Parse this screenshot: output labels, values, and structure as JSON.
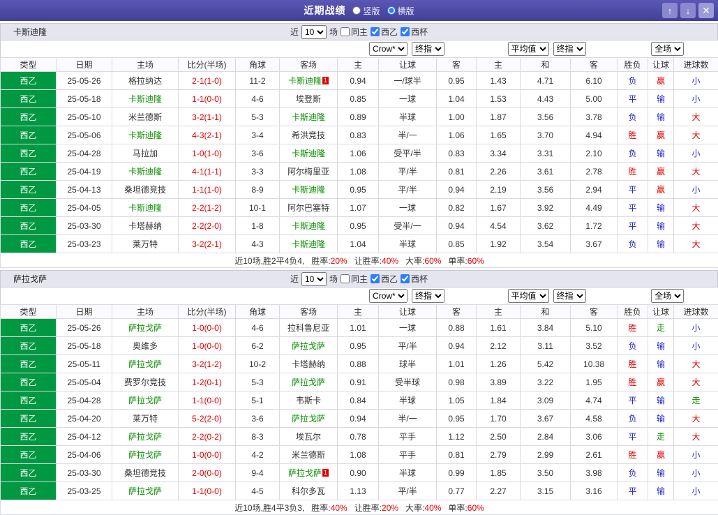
{
  "titlebar": {
    "title": "近期战绩",
    "layout_options": [
      {
        "label": "竖版",
        "selected": false
      },
      {
        "label": "横版",
        "selected": true
      }
    ],
    "icons": {
      "up": "↑",
      "down": "↓",
      "close": "✕"
    }
  },
  "labels": {
    "near": "近",
    "count": "10",
    "matches": "场",
    "same_home": "同主",
    "league_a": "西乙",
    "league_b": "西杯",
    "crow": "Crow*",
    "final_odds": "终指",
    "average": "平均值",
    "full_match": "全场",
    "cols": [
      "类型",
      "日期",
      "主场",
      "比分(半场)",
      "角球",
      "客场",
      "主",
      "让球",
      "客",
      "主",
      "和",
      "客",
      "胜负",
      "让球",
      "进球数"
    ]
  },
  "sections": [
    {
      "team": "卡斯迪隆",
      "rows": [
        {
          "league": "西乙",
          "date": "25-05-26",
          "home": "格拉纳达",
          "home_focal": false,
          "score": "2-1(1-0)",
          "corners": "11-2",
          "away": "卡斯迪隆",
          "away_focal": true,
          "away_card": "1",
          "odds": [
            "0.94",
            "一/球半",
            "0.95"
          ],
          "avg": [
            "1.43",
            "4.71",
            "6.10"
          ],
          "win_loss": "负",
          "handicap_result": "赢",
          "goals": "小"
        },
        {
          "league": "西乙",
          "date": "25-05-18",
          "home": "卡斯迪隆",
          "home_focal": true,
          "score": "1-1(0-0)",
          "corners": "4-6",
          "away": "埃登斯",
          "away_focal": false,
          "odds": [
            "0.85",
            "一球",
            "1.04"
          ],
          "avg": [
            "1.53",
            "4.43",
            "5.00"
          ],
          "win_loss": "平",
          "handicap_result": "输",
          "goals": "小"
        },
        {
          "league": "西乙",
          "date": "25-05-10",
          "home": "米兰德斯",
          "home_focal": false,
          "score": "3-2(1-1)",
          "corners": "5-3",
          "away": "卡斯迪隆",
          "away_focal": true,
          "odds": [
            "0.89",
            "半球",
            "1.00"
          ],
          "avg": [
            "1.87",
            "3.56",
            "3.78"
          ],
          "win_loss": "负",
          "handicap_result": "输",
          "goals": "大"
        },
        {
          "league": "西乙",
          "date": "25-05-06",
          "home": "卡斯迪隆",
          "home_focal": true,
          "score": "4-3(2-1)",
          "corners": "3-4",
          "away": "希洪竞技",
          "away_focal": false,
          "odds": [
            "0.83",
            "半/一",
            "1.06"
          ],
          "avg": [
            "1.65",
            "3.70",
            "4.94"
          ],
          "win_loss": "胜",
          "handicap_result": "赢",
          "goals": "大"
        },
        {
          "league": "西乙",
          "date": "25-04-28",
          "home": "马拉加",
          "home_focal": false,
          "score": "1-0(1-0)",
          "corners": "3-6",
          "away": "卡斯迪隆",
          "away_focal": true,
          "odds": [
            "1.06",
            "受平/半",
            "0.83"
          ],
          "avg": [
            "3.34",
            "3.31",
            "2.10"
          ],
          "win_loss": "负",
          "handicap_result": "输",
          "goals": "小"
        },
        {
          "league": "西乙",
          "date": "25-04-19",
          "home": "卡斯迪隆",
          "home_focal": true,
          "score": "4-1(1-1)",
          "corners": "3-3",
          "away": "阿尔梅里亚",
          "away_focal": false,
          "odds": [
            "1.08",
            "平/半",
            "0.81"
          ],
          "avg": [
            "2.26",
            "3.61",
            "2.78"
          ],
          "win_loss": "胜",
          "handicap_result": "赢",
          "goals": "大"
        },
        {
          "league": "西乙",
          "date": "25-04-13",
          "home": "桑坦德竞技",
          "home_focal": false,
          "score": "1-1(1-0)",
          "corners": "8-9",
          "away": "卡斯迪隆",
          "away_focal": true,
          "odds": [
            "0.95",
            "平/半",
            "0.94"
          ],
          "avg": [
            "2.19",
            "3.56",
            "2.94"
          ],
          "win_loss": "平",
          "handicap_result": "赢",
          "goals": "小"
        },
        {
          "league": "西乙",
          "date": "25-04-05",
          "home": "卡斯迪隆",
          "home_focal": true,
          "score": "2-2(1-2)",
          "corners": "10-1",
          "away": "阿尔巴塞特",
          "away_focal": false,
          "odds": [
            "1.07",
            "一球",
            "0.82"
          ],
          "avg": [
            "1.67",
            "3.92",
            "4.49"
          ],
          "win_loss": "平",
          "handicap_result": "输",
          "goals": "大"
        },
        {
          "league": "西乙",
          "date": "25-03-30",
          "home": "卡塔赫纳",
          "home_focal": false,
          "score": "2-2(2-0)",
          "corners": "1-8",
          "away": "卡斯迪隆",
          "away_focal": true,
          "odds": [
            "0.95",
            "受半/一",
            "0.94"
          ],
          "avg": [
            "4.54",
            "3.62",
            "1.72"
          ],
          "win_loss": "平",
          "handicap_result": "输",
          "goals": "大"
        },
        {
          "league": "西乙",
          "date": "25-03-23",
          "home": "莱万特",
          "home_focal": false,
          "score": "3-2(2-1)",
          "corners": "4-3",
          "away": "卡斯迪隆",
          "away_focal": true,
          "odds": [
            "1.04",
            "半球",
            "0.85"
          ],
          "avg": [
            "1.92",
            "3.54",
            "3.67"
          ],
          "win_loss": "负",
          "handicap_result": "输",
          "goals": "大"
        }
      ],
      "summary": {
        "record": "近10场,胜2平4负4,",
        "stats": [
          {
            "label": "胜率:",
            "value": "20%"
          },
          {
            "label": "让胜率:",
            "value": "40%"
          },
          {
            "label": "大率:",
            "value": "60%"
          },
          {
            "label": "单率:",
            "value": "60%"
          }
        ]
      }
    },
    {
      "team": "萨拉戈萨",
      "rows": [
        {
          "league": "西乙",
          "date": "25-05-26",
          "home": "萨拉戈萨",
          "home_focal": true,
          "score": "1-0(0-0)",
          "corners": "4-6",
          "away": "拉科鲁尼亚",
          "away_focal": false,
          "odds": [
            "1.01",
            "一球",
            "0.88"
          ],
          "avg": [
            "1.61",
            "3.84",
            "5.10"
          ],
          "win_loss": "胜",
          "handicap_result": "走",
          "goals": "小"
        },
        {
          "league": "西乙",
          "date": "25-05-18",
          "home": "奥维多",
          "home_focal": false,
          "score": "1-0(0-0)",
          "corners": "6-2",
          "away": "萨拉戈萨",
          "away_focal": true,
          "odds": [
            "0.95",
            "平/半",
            "0.94"
          ],
          "avg": [
            "2.12",
            "3.11",
            "3.52"
          ],
          "win_loss": "负",
          "handicap_result": "输",
          "goals": "小"
        },
        {
          "league": "西乙",
          "date": "25-05-11",
          "home": "萨拉戈萨",
          "home_focal": true,
          "score": "3-2(1-2)",
          "corners": "10-2",
          "away": "卡塔赫纳",
          "away_focal": false,
          "odds": [
            "0.88",
            "球半",
            "1.01"
          ],
          "avg": [
            "1.26",
            "5.42",
            "10.38"
          ],
          "win_loss": "胜",
          "handicap_result": "输",
          "goals": "大"
        },
        {
          "league": "西乙",
          "date": "25-05-04",
          "home": "费罗尔竞技",
          "home_focal": false,
          "score": "1-2(0-1)",
          "corners": "5-3",
          "away": "萨拉戈萨",
          "away_focal": true,
          "odds": [
            "0.91",
            "受半球",
            "0.98"
          ],
          "avg": [
            "3.89",
            "3.22",
            "1.95"
          ],
          "win_loss": "胜",
          "handicap_result": "赢",
          "goals": "大"
        },
        {
          "league": "西乙",
          "date": "25-04-28",
          "home": "萨拉戈萨",
          "home_focal": true,
          "score": "1-1(0-0)",
          "corners": "5-1",
          "away": "韦斯卡",
          "away_focal": false,
          "odds": [
            "0.84",
            "半球",
            "1.05"
          ],
          "avg": [
            "1.84",
            "3.09",
            "4.74"
          ],
          "win_loss": "平",
          "handicap_result": "输",
          "goals": "走"
        },
        {
          "league": "西乙",
          "date": "25-04-20",
          "home": "莱万特",
          "home_focal": false,
          "score": "5-2(2-0)",
          "corners": "3-6",
          "away": "萨拉戈萨",
          "away_focal": true,
          "odds": [
            "0.94",
            "半/一",
            "0.95"
          ],
          "avg": [
            "1.70",
            "3.67",
            "4.58"
          ],
          "win_loss": "负",
          "handicap_result": "输",
          "goals": "大"
        },
        {
          "league": "西乙",
          "date": "25-04-12",
          "home": "萨拉戈萨",
          "home_focal": true,
          "score": "2-2(0-2)",
          "corners": "8-3",
          "away": "埃瓦尔",
          "away_focal": false,
          "odds": [
            "0.78",
            "平手",
            "1.12"
          ],
          "avg": [
            "2.50",
            "2.84",
            "3.06"
          ],
          "win_loss": "平",
          "handicap_result": "走",
          "goals": "大"
        },
        {
          "league": "西乙",
          "date": "25-04-06",
          "home": "萨拉戈萨",
          "home_focal": true,
          "score": "1-0(0-0)",
          "corners": "4-2",
          "away": "米兰德斯",
          "away_focal": false,
          "odds": [
            "1.08",
            "平手",
            "0.81"
          ],
          "avg": [
            "2.79",
            "2.99",
            "2.61"
          ],
          "win_loss": "胜",
          "handicap_result": "赢",
          "goals": "小"
        },
        {
          "league": "西乙",
          "date": "25-03-30",
          "home": "桑坦德竞技",
          "home_focal": false,
          "score": "2-0(0-0)",
          "corners": "9-4",
          "away": "萨拉戈萨",
          "away_focal": true,
          "away_card": "1",
          "odds": [
            "0.90",
            "半球",
            "0.99"
          ],
          "avg": [
            "1.85",
            "3.50",
            "3.98"
          ],
          "win_loss": "负",
          "handicap_result": "输",
          "goals": "小"
        },
        {
          "league": "西乙",
          "date": "25-03-25",
          "home": "萨拉戈萨",
          "home_focal": true,
          "score": "1-1(0-0)",
          "corners": "4-5",
          "away": "科尔多瓦",
          "away_focal": false,
          "odds": [
            "1.13",
            "平/半",
            "0.77"
          ],
          "avg": [
            "2.27",
            "3.15",
            "3.16"
          ],
          "win_loss": "平",
          "handicap_result": "输",
          "goals": "小"
        }
      ],
      "summary": {
        "record": "近10场,胜4平3负3,",
        "stats": [
          {
            "label": "胜率:",
            "value": "40%"
          },
          {
            "label": "让胜率:",
            "value": "20%"
          },
          {
            "label": "大率:",
            "value": "40%"
          },
          {
            "label": "单率:",
            "value": "60%"
          }
        ]
      }
    }
  ]
}
